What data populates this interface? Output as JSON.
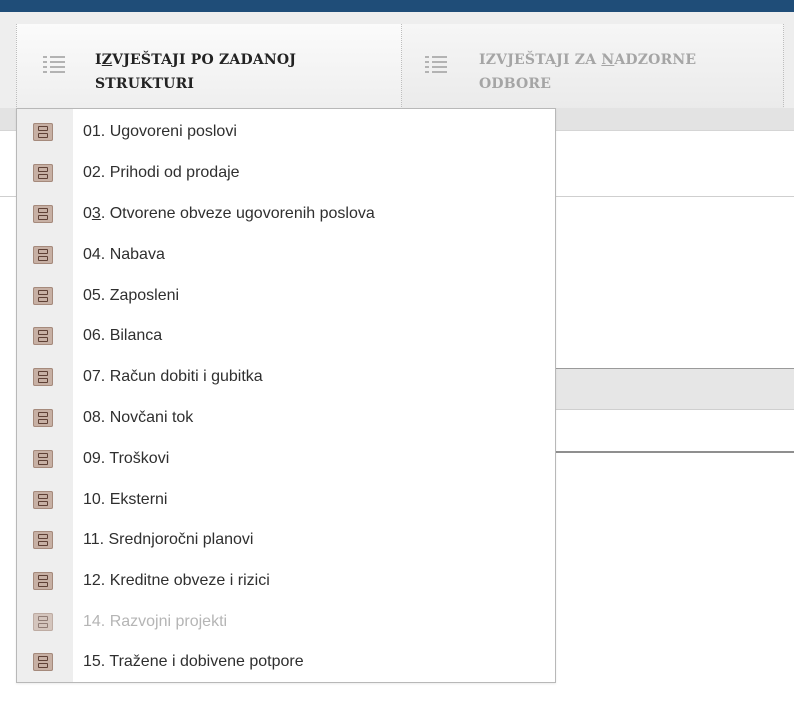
{
  "colors": {
    "topbar": "#1f4d78",
    "tab_active_text": "#222222",
    "tab_inactive_text": "#a5a5a5",
    "menu_text": "#2f2f2f",
    "menu_disabled_text": "#b5b5b5",
    "menu_icon": "#c7b0a4"
  },
  "tabs": [
    {
      "label_pre": "I",
      "label_underlined": "Z",
      "label_post": "VJEŠTAJI PO ZADANOJ STRUKTURI",
      "icon": "list-icon",
      "active": true
    },
    {
      "label_pre": "IZVJEŠTAJI ZA ",
      "label_underlined": "N",
      "label_post": "ADZORNE ODBORE",
      "icon": "list-icon",
      "active": false
    }
  ],
  "menu": {
    "items": [
      {
        "pre": "01. Ugovoreni poslovi",
        "u": "",
        "post": "",
        "icon": "report-icon",
        "disabled": false
      },
      {
        "pre": "02. Prihodi od prodaje",
        "u": "",
        "post": "",
        "icon": "report-icon",
        "disabled": false
      },
      {
        "pre": "0",
        "u": "3",
        "post": ". Otvorene obveze ugovorenih poslova",
        "icon": "report-icon",
        "disabled": false
      },
      {
        "pre": "04. Nabava",
        "u": "",
        "post": "",
        "icon": "report-icon",
        "disabled": false
      },
      {
        "pre": "05. Zaposleni",
        "u": "",
        "post": "",
        "icon": "report-icon",
        "disabled": false
      },
      {
        "pre": "06. Bilanca",
        "u": "",
        "post": "",
        "icon": "report-icon",
        "disabled": false
      },
      {
        "pre": "07. Račun dobiti i gubitka",
        "u": "",
        "post": "",
        "icon": "report-icon",
        "disabled": false
      },
      {
        "pre": "08. Novčani tok",
        "u": "",
        "post": "",
        "icon": "report-icon",
        "disabled": false
      },
      {
        "pre": "09. Troškovi",
        "u": "",
        "post": "",
        "icon": "report-icon",
        "disabled": false
      },
      {
        "pre": "10. Eksterni",
        "u": "",
        "post": "",
        "icon": "report-icon",
        "disabled": false
      },
      {
        "pre": "11. Srednjoročni planovi",
        "u": "",
        "post": "",
        "icon": "report-icon",
        "disabled": false
      },
      {
        "pre": "12. Kreditne obveze i rizici",
        "u": "",
        "post": "",
        "icon": "report-icon",
        "disabled": false
      },
      {
        "pre": "14. Razvojni projekti",
        "u": "",
        "post": "",
        "icon": "report-icon",
        "disabled": true
      },
      {
        "pre": "15. Tražene i dobivene potpore",
        "u": "",
        "post": "",
        "icon": "report-icon",
        "disabled": false
      }
    ]
  }
}
